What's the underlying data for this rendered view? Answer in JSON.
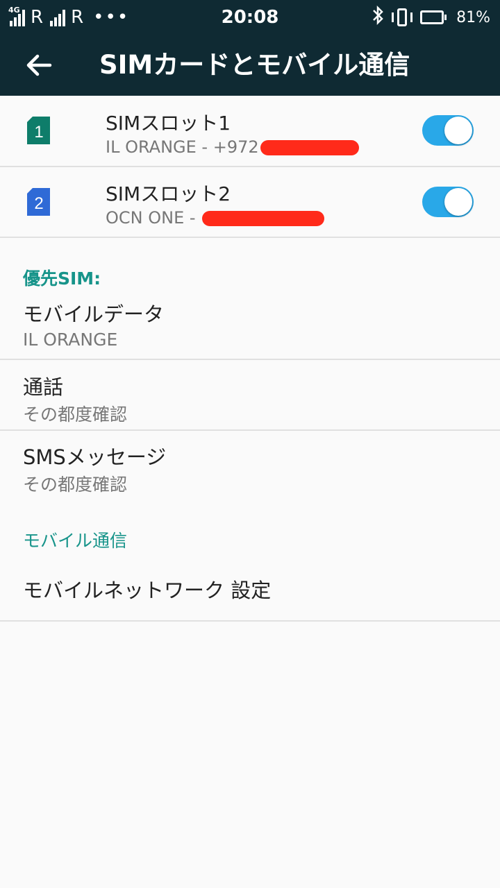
{
  "status_bar": {
    "network_type": "4G",
    "roaming_1": "R",
    "roaming_2": "R",
    "overflow": "•••",
    "time": "20:08",
    "battery_level": 0.81,
    "battery_text": "81%",
    "icons": [
      "signal-icon",
      "bluetooth-icon",
      "vibrate-icon",
      "battery-icon"
    ]
  },
  "app_bar": {
    "title": "SIMカードとモバイル通信",
    "back_icon": "arrow-left-icon",
    "background": "#0f2a33"
  },
  "sim_slots": [
    {
      "title": "SIMスロット1",
      "subtitle_prefix": "IL ORANGE - +972",
      "enabled": true,
      "icon_number": "1",
      "icon_color": "#0e7d6a"
    },
    {
      "title": "SIMスロット2",
      "subtitle_prefix": "OCN ONE - ",
      "enabled": true,
      "icon_number": "2",
      "icon_color": "#2f6ad6"
    }
  ],
  "preferred_sim": {
    "header": "優先SIM:",
    "items": [
      {
        "title": "モバイルデータ",
        "value": "IL ORANGE"
      },
      {
        "title": "通話",
        "value": "その都度確認"
      },
      {
        "title": "SMSメッセージ",
        "value": "その都度確認"
      }
    ]
  },
  "mobile_comm": {
    "header": "モバイル通信",
    "items": [
      {
        "title": "モバイルネットワーク 設定"
      }
    ]
  },
  "colors": {
    "accent": "#17948a",
    "toggle_on": "#29a8e8",
    "redaction": "#ff2a1a"
  }
}
